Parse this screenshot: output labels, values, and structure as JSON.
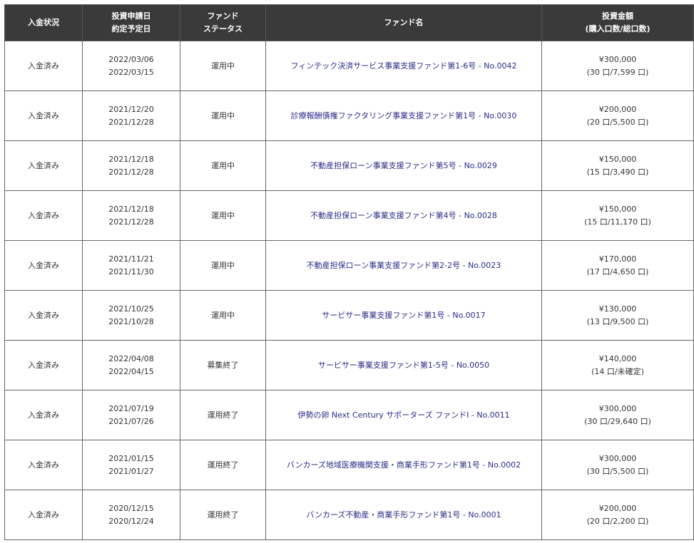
{
  "headers": {
    "status": "入金状況",
    "date_line1": "投資申請日",
    "date_line2": "約定予定日",
    "fund_status_line1": "ファンド",
    "fund_status_line2": "ステータス",
    "fund_name": "ファンド名",
    "amount_line1": "投資金額",
    "amount_line2": "(購入口数/総口数)"
  },
  "rows": [
    {
      "payment_status": "入金済み",
      "apply_date": "2022/03/06",
      "contract_date": "2022/03/15",
      "fund_status": "運用中",
      "fund_name": "フィンテック決済サービス事業支援ファンド第1-6号 - No.0042",
      "amount": "¥300,000",
      "units": "(30 口/7,599 口)"
    },
    {
      "payment_status": "入金済み",
      "apply_date": "2021/12/20",
      "contract_date": "2021/12/28",
      "fund_status": "運用中",
      "fund_name": "診療報酬債権ファクタリング事業支援ファンド第1号 - No.0030",
      "amount": "¥200,000",
      "units": "(20 口/5,500 口)"
    },
    {
      "payment_status": "入金済み",
      "apply_date": "2021/12/18",
      "contract_date": "2021/12/28",
      "fund_status": "運用中",
      "fund_name": "不動産担保ローン事業支援ファンド第5号 - No.0029",
      "amount": "¥150,000",
      "units": "(15 口/3,490 口)"
    },
    {
      "payment_status": "入金済み",
      "apply_date": "2021/12/18",
      "contract_date": "2021/12/28",
      "fund_status": "運用中",
      "fund_name": "不動産担保ローン事業支援ファンド第4号 - No.0028",
      "amount": "¥150,000",
      "units": "(15 口/11,170 口)"
    },
    {
      "payment_status": "入金済み",
      "apply_date": "2021/11/21",
      "contract_date": "2021/11/30",
      "fund_status": "運用中",
      "fund_name": "不動産担保ローン事業支援ファンド第2-2号 - No.0023",
      "amount": "¥170,000",
      "units": "(17 口/4,650 口)"
    },
    {
      "payment_status": "入金済み",
      "apply_date": "2021/10/25",
      "contract_date": "2021/10/28",
      "fund_status": "運用中",
      "fund_name": "サービサー事業支援ファンド第1号 - No.0017",
      "amount": "¥130,000",
      "units": "(13 口/9,500 口)"
    },
    {
      "payment_status": "入金済み",
      "apply_date": "2022/04/08",
      "contract_date": "2022/04/15",
      "fund_status": "募集終了",
      "fund_name": "サービサー事業支援ファンド第1-5号 - No.0050",
      "amount": "¥140,000",
      "units": "(14 口/未確定)"
    },
    {
      "payment_status": "入金済み",
      "apply_date": "2021/07/19",
      "contract_date": "2021/07/26",
      "fund_status": "運用終了",
      "fund_name": "伊勢の卵 Next Century サポーターズ ファンドⅠ - No.0011",
      "amount": "¥300,000",
      "units": "(30 口/29,640 口)"
    },
    {
      "payment_status": "入金済み",
      "apply_date": "2021/01/15",
      "contract_date": "2021/01/27",
      "fund_status": "運用終了",
      "fund_name": "バンカーズ地域医療機関支援・商業手形ファンド第1号 - No.0002",
      "amount": "¥300,000",
      "units": "(30 口/5,500 口)"
    },
    {
      "payment_status": "入金済み",
      "apply_date": "2020/12/15",
      "contract_date": "2020/12/24",
      "fund_status": "運用終了",
      "fund_name": "バンカーズ不動産・商業手形ファンド第1号 - No.0001",
      "amount": "¥200,000",
      "units": "(20 口/2,200 口)"
    }
  ]
}
